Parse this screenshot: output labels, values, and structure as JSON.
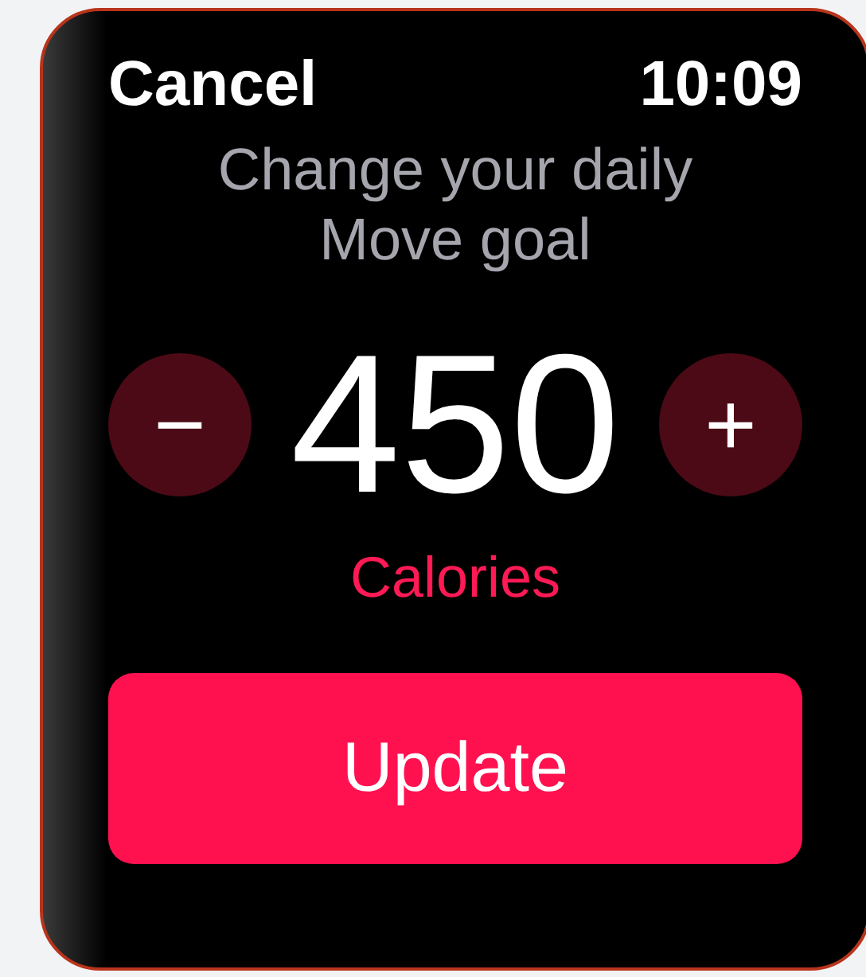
{
  "header": {
    "cancel": "Cancel",
    "time": "10:09"
  },
  "title": "Change your daily Move goal",
  "goal": {
    "value": "450",
    "unit": "Calories",
    "decrement": "−",
    "increment": "+"
  },
  "update_button": "Update"
}
